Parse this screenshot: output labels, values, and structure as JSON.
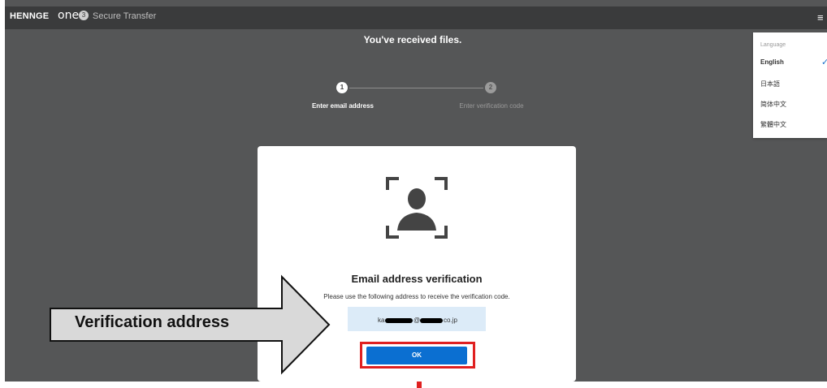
{
  "app": {
    "logo_text": "HENNGE",
    "logo_one": "one",
    "logo_mark": "3",
    "product": "Secure Transfer",
    "menu_icon": "hamburger-menu-icon"
  },
  "page": {
    "title": "You've received files."
  },
  "steps": [
    {
      "number": "1",
      "label": "Enter email address",
      "active": true
    },
    {
      "number": "2",
      "label": "Enter verification code",
      "active": false
    }
  ],
  "card": {
    "icon": "user-verification-icon",
    "title": "Email address verification",
    "description": "Please use the following address to receive the verification code.",
    "address": {
      "prefix": "ka",
      "mid": "@",
      "suffix": "co.jp"
    },
    "ok_label": "OK"
  },
  "language_menu": {
    "header": "Language",
    "items": [
      "English",
      "日本語",
      "简体中文",
      "繁體中文"
    ],
    "selected": "English",
    "check_icon": "check-icon"
  },
  "annotation": {
    "arrow_label": "Verification address",
    "highlight_color": "#e02020"
  },
  "colors": {
    "background": "#555657",
    "topbar": "#3a3b3c",
    "primary_button": "#0b6fd1",
    "address_box": "#dcebf8"
  }
}
